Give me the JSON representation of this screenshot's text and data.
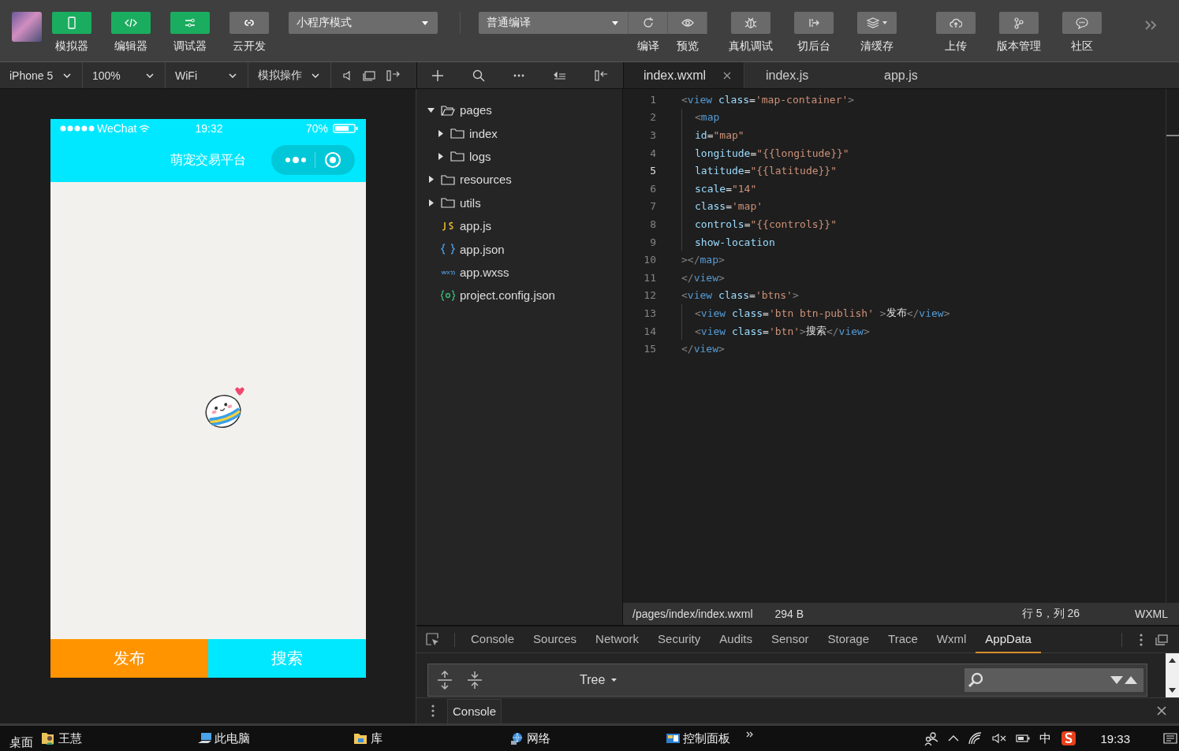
{
  "toolbar": {
    "tools": [
      {
        "label": "模拟器",
        "on": true
      },
      {
        "label": "编辑器",
        "on": true
      },
      {
        "label": "调试器",
        "on": true
      },
      {
        "label": "云开发",
        "on": false
      }
    ],
    "mode_select": {
      "value": "小程序模式"
    },
    "compile_select": {
      "value": "普通编译"
    },
    "actions": [
      {
        "label": "编译"
      },
      {
        "label": "预览"
      },
      {
        "label": "真机调试"
      },
      {
        "label": "切后台"
      },
      {
        "label": "清缓存"
      },
      {
        "label": "上传"
      },
      {
        "label": "版本管理"
      },
      {
        "label": "社区"
      }
    ]
  },
  "simulator_bar": [
    {
      "value": "iPhone 5"
    },
    {
      "value": "100%"
    },
    {
      "value": "WiFi"
    },
    {
      "value": "模拟操作"
    }
  ],
  "phone": {
    "carrier": "WeChat",
    "time": "19:32",
    "battery": "70%",
    "nav_title": "萌宠交易平台",
    "buttons": [
      {
        "label": "发布",
        "color": "#ff9400"
      },
      {
        "label": "搜索",
        "color": "#00e8ff"
      }
    ]
  },
  "file_tree": [
    {
      "name": "pages",
      "kind": "folder",
      "expanded": true,
      "children": [
        {
          "name": "index",
          "kind": "folder",
          "expanded": false
        },
        {
          "name": "logs",
          "kind": "folder",
          "expanded": false
        }
      ]
    },
    {
      "name": "resources",
      "kind": "folder",
      "expanded": false
    },
    {
      "name": "utils",
      "kind": "folder",
      "expanded": false
    },
    {
      "name": "app.js",
      "kind": "js"
    },
    {
      "name": "app.json",
      "kind": "json"
    },
    {
      "name": "app.wxss",
      "kind": "wxss"
    },
    {
      "name": "project.config.json",
      "kind": "config"
    }
  ],
  "editor": {
    "tabs": [
      {
        "label": "index.wxml",
        "selected": true
      },
      {
        "label": "index.js",
        "selected": false
      },
      {
        "label": "app.js",
        "selected": false
      }
    ],
    "lines": [
      {
        "number": "1",
        "active": false,
        "nested": false,
        "tokens": [
          {
            "kind": "punct",
            "text": "<"
          },
          {
            "kind": "tag",
            "text": "view"
          },
          {
            "kind": "attr",
            "text": " class"
          },
          {
            "kind": "plain",
            "text": "="
          },
          {
            "kind": "string",
            "text": "'map-container'"
          },
          {
            "kind": "punct",
            "text": ">"
          }
        ]
      },
      {
        "number": "2",
        "active": false,
        "nested": true,
        "tokens": [
          {
            "kind": "punct",
            "text": "<"
          },
          {
            "kind": "tag",
            "text": "map"
          }
        ]
      },
      {
        "number": "3",
        "active": false,
        "nested": true,
        "tokens": [
          {
            "kind": "attr",
            "text": "id"
          },
          {
            "kind": "plain",
            "text": "="
          },
          {
            "kind": "string",
            "text": "\"map\""
          }
        ]
      },
      {
        "number": "4",
        "active": false,
        "nested": true,
        "tokens": [
          {
            "kind": "attr",
            "text": "longitude"
          },
          {
            "kind": "plain",
            "text": "="
          },
          {
            "kind": "string",
            "text": "\"{{longitude}}\""
          }
        ]
      },
      {
        "number": "5",
        "active": true,
        "nested": true,
        "tokens": [
          {
            "kind": "attr",
            "text": "latitude"
          },
          {
            "kind": "plain",
            "text": "="
          },
          {
            "kind": "string",
            "text": "\"{{latitude}}\""
          }
        ]
      },
      {
        "number": "6",
        "active": false,
        "nested": true,
        "tokens": [
          {
            "kind": "attr",
            "text": "scale"
          },
          {
            "kind": "plain",
            "text": "="
          },
          {
            "kind": "string",
            "text": "\"14\""
          }
        ]
      },
      {
        "number": "7",
        "active": false,
        "nested": true,
        "tokens": [
          {
            "kind": "attr",
            "text": "class"
          },
          {
            "kind": "plain",
            "text": "="
          },
          {
            "kind": "string",
            "text": "'map'"
          }
        ]
      },
      {
        "number": "8",
        "active": false,
        "nested": true,
        "tokens": [
          {
            "kind": "attr",
            "text": "controls"
          },
          {
            "kind": "plain",
            "text": "="
          },
          {
            "kind": "string",
            "text": "\"{{controls}}\""
          }
        ]
      },
      {
        "number": "9",
        "active": false,
        "nested": true,
        "tokens": [
          {
            "kind": "attr",
            "text": "show-location"
          }
        ]
      },
      {
        "number": "10",
        "active": false,
        "nested": false,
        "tokens": [
          {
            "kind": "punct",
            "text": "></"
          },
          {
            "kind": "tag",
            "text": "map"
          },
          {
            "kind": "punct",
            "text": ">"
          }
        ]
      },
      {
        "number": "11",
        "active": false,
        "nested": false,
        "tokens": [
          {
            "kind": "punct",
            "text": "</"
          },
          {
            "kind": "tag",
            "text": "view"
          },
          {
            "kind": "punct",
            "text": ">"
          }
        ]
      },
      {
        "number": "12",
        "active": false,
        "nested": false,
        "tokens": [
          {
            "kind": "punct",
            "text": "<"
          },
          {
            "kind": "tag",
            "text": "view"
          },
          {
            "kind": "attr",
            "text": " class"
          },
          {
            "kind": "plain",
            "text": "="
          },
          {
            "kind": "string",
            "text": "'btns'"
          },
          {
            "kind": "punct",
            "text": ">"
          }
        ]
      },
      {
        "number": "13",
        "active": false,
        "nested": true,
        "tokens": [
          {
            "kind": "punct",
            "text": "<"
          },
          {
            "kind": "tag",
            "text": "view"
          },
          {
            "kind": "attr",
            "text": " class"
          },
          {
            "kind": "plain",
            "text": "="
          },
          {
            "kind": "string",
            "text": "'btn btn-publish'"
          },
          {
            "kind": "punct",
            "text": " >"
          },
          {
            "kind": "plain",
            "text": "发布"
          },
          {
            "kind": "punct",
            "text": "</"
          },
          {
            "kind": "tag",
            "text": "view"
          },
          {
            "kind": "punct",
            "text": ">"
          }
        ]
      },
      {
        "number": "14",
        "active": false,
        "nested": true,
        "tokens": [
          {
            "kind": "punct",
            "text": "<"
          },
          {
            "kind": "tag",
            "text": "view"
          },
          {
            "kind": "attr",
            "text": " class"
          },
          {
            "kind": "plain",
            "text": "="
          },
          {
            "kind": "string",
            "text": "'btn'"
          },
          {
            "kind": "punct",
            "text": ">"
          },
          {
            "kind": "plain",
            "text": "搜索"
          },
          {
            "kind": "punct",
            "text": "</"
          },
          {
            "kind": "tag",
            "text": "view"
          },
          {
            "kind": "punct",
            "text": ">"
          }
        ]
      },
      {
        "number": "15",
        "active": false,
        "nested": false,
        "tokens": [
          {
            "kind": "punct",
            "text": "</"
          },
          {
            "kind": "tag",
            "text": "view"
          },
          {
            "kind": "punct",
            "text": ">"
          }
        ]
      }
    ],
    "status": {
      "path": "/pages/index/index.wxml",
      "size": "294 B",
      "position": "行 5，列 26",
      "language": "WXML"
    }
  },
  "devtools": {
    "tabs": [
      {
        "label": "Console",
        "selected": false
      },
      {
        "label": "Sources",
        "selected": false
      },
      {
        "label": "Network",
        "selected": false
      },
      {
        "label": "Security",
        "selected": false
      },
      {
        "label": "Audits",
        "selected": false
      },
      {
        "label": "Sensor",
        "selected": false
      },
      {
        "label": "Storage",
        "selected": false
      },
      {
        "label": "Trace",
        "selected": false
      },
      {
        "label": "Wxml",
        "selected": false
      },
      {
        "label": "AppData",
        "selected": true
      }
    ],
    "view_select": "Tree",
    "drawer_tab": "Console"
  },
  "taskbar": {
    "desktop": "桌面",
    "items": [
      {
        "label": "王慧"
      },
      {
        "label": "此电脑"
      },
      {
        "label": "库"
      },
      {
        "label": "网络"
      },
      {
        "label": "控制面板"
      }
    ],
    "ime": "中",
    "time": "19:33"
  }
}
